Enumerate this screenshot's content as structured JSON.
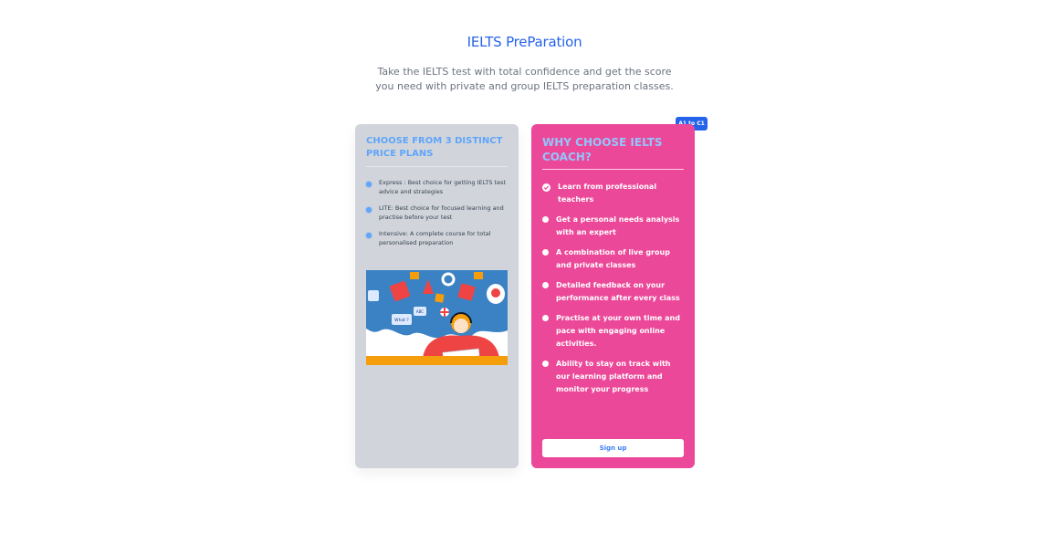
{
  "hero": {
    "title": "IELTS PreParation",
    "subtitle_line1": "Take the IELTS test with total confidence and get the score",
    "subtitle_line2": "you need with private and group IELTS preparation classes."
  },
  "plans_card": {
    "title": "CHOOSE FROM 3 DISTINCT PRICE PLANS",
    "items": [
      {
        "text": "Express : Best choice for getting IELTS test advice and strategies"
      },
      {
        "text": "LITE: Best choice for focused learning and practise before your test"
      },
      {
        "text": "Intensive: A complete course for total personalised preparation"
      }
    ],
    "illustration_text": {
      "bubble_what": "What ?",
      "bubble_abc": "ABC"
    }
  },
  "why_card": {
    "badge": "A1 to C1",
    "title": "WHY CHOOSE IELTS COACH?",
    "items": [
      {
        "text": "Learn from professional teachers"
      },
      {
        "text": "Get a personal needs analysis with an expert"
      },
      {
        "text": "A combination of live group and private classes"
      },
      {
        "text": "Detailed feedback on your performance after every class"
      },
      {
        "text": "Practise at your own time and pace with engaging online activities."
      },
      {
        "text": "Ability to stay on track with our learning platform and monitor your progress"
      }
    ],
    "signup_label": "Sign up"
  },
  "colors": {
    "accent_blue": "#2563eb",
    "card_pink": "#ec4899",
    "card_gray": "#d1d5db"
  }
}
